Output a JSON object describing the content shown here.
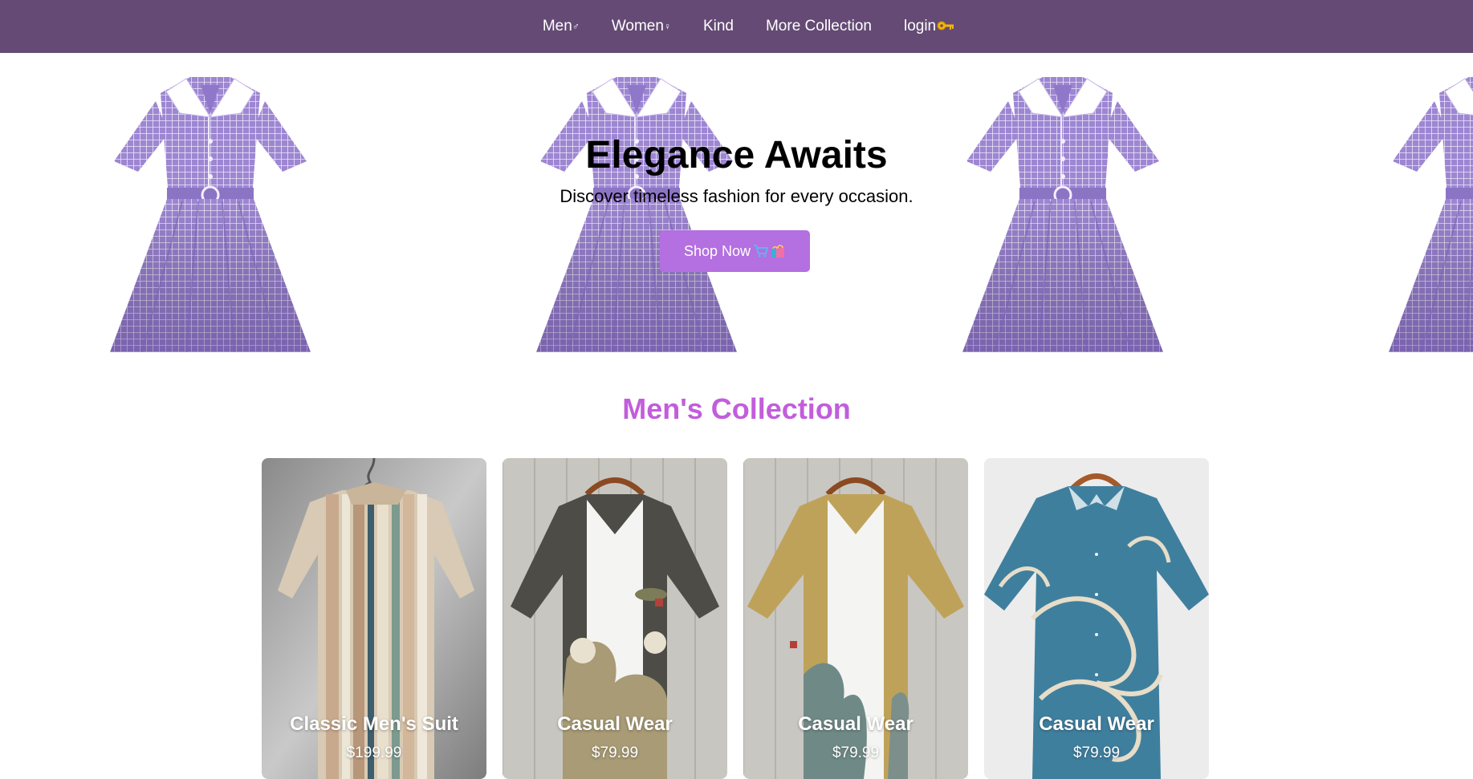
{
  "nav": {
    "items": [
      {
        "label": "Men",
        "icon": "♂",
        "icon_name": "male-sign-icon"
      },
      {
        "label": "Women",
        "icon": "♀",
        "icon_name": "female-sign-icon"
      },
      {
        "label": "Kind",
        "icon": ""
      },
      {
        "label": "More Collection",
        "icon": ""
      },
      {
        "label": "login",
        "icon": "key-icon"
      }
    ],
    "background": "#644a74"
  },
  "hero": {
    "title": "Elegance Awaits",
    "subtitle": "Discover timeless fashion for every occasion.",
    "button_label": "Shop Now",
    "button_icons": [
      "shopping-cart-icon",
      "shopping-bags-icon"
    ],
    "button_color": "#b46fe0",
    "dress_color": "#9b84cf"
  },
  "men_collection": {
    "title": "Men's Collection",
    "title_color": "#c25ddb",
    "products": [
      {
        "name": "Classic Men's Suit",
        "price": "$199.99"
      },
      {
        "name": "Casual Wear",
        "price": "$79.99"
      },
      {
        "name": "Casual Wear",
        "price": "$79.99"
      },
      {
        "name": "Casual Wear",
        "price": "$79.99"
      }
    ]
  }
}
